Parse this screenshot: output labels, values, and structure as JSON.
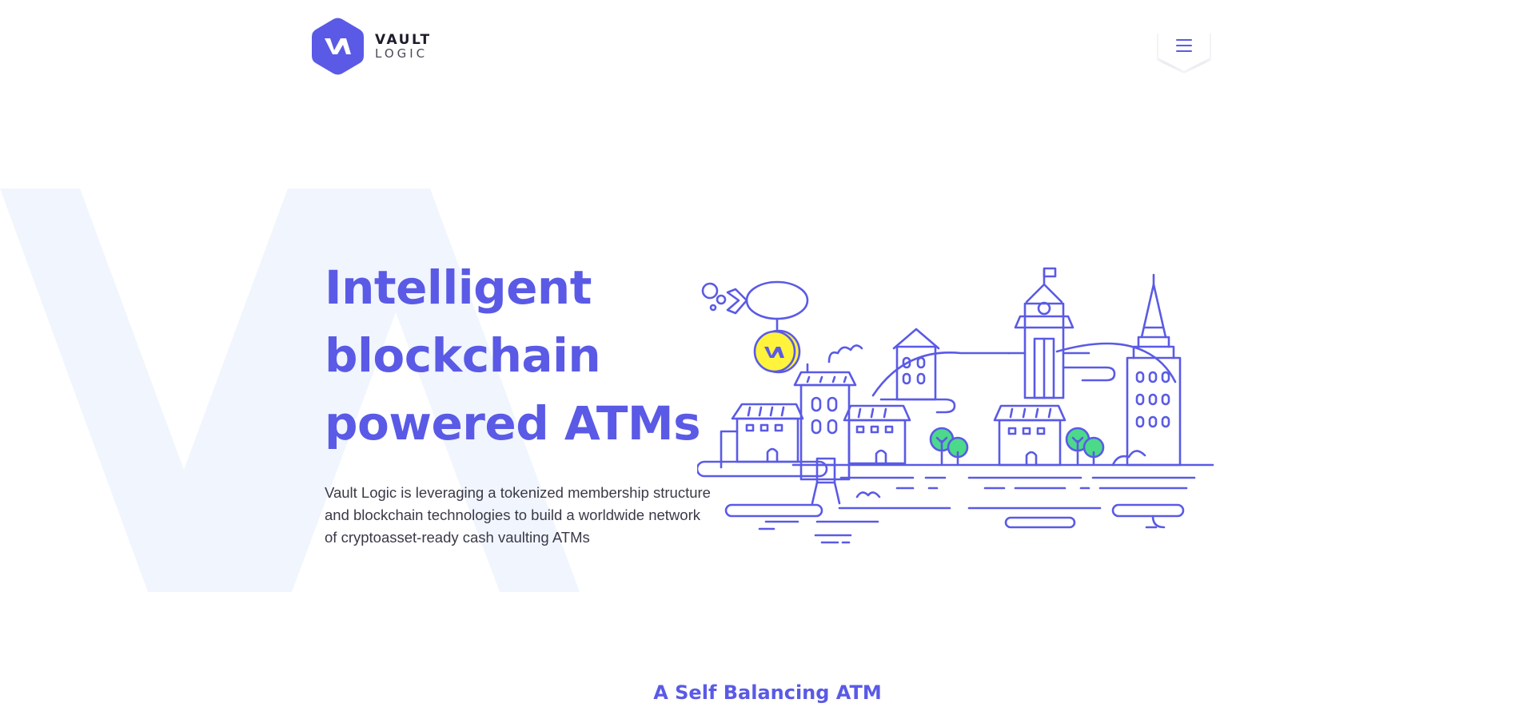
{
  "colors": {
    "accent": "#5a5ae6",
    "bg_mark": "#f1f5fd",
    "coin": "#fff33b",
    "tree": "#4cd98a",
    "text": "#3a3a48"
  },
  "header": {
    "logo": {
      "word1": "VAULT",
      "word2": "LOGIC",
      "mark": "va-hexagon-icon"
    },
    "menu_icon": "hamburger-menu-icon"
  },
  "hero": {
    "title_lines": [
      "Intelligent",
      "blockchain",
      "powered ATMs"
    ],
    "description": "Vault Logic is leveraging a tokenized membership structure and blockchain technologies to build a worldwide network of cryptoasset-ready cash vaulting ATMs",
    "illustration": "city-skyline-illustration"
  },
  "section": {
    "title": "A Self Balancing ATM"
  }
}
